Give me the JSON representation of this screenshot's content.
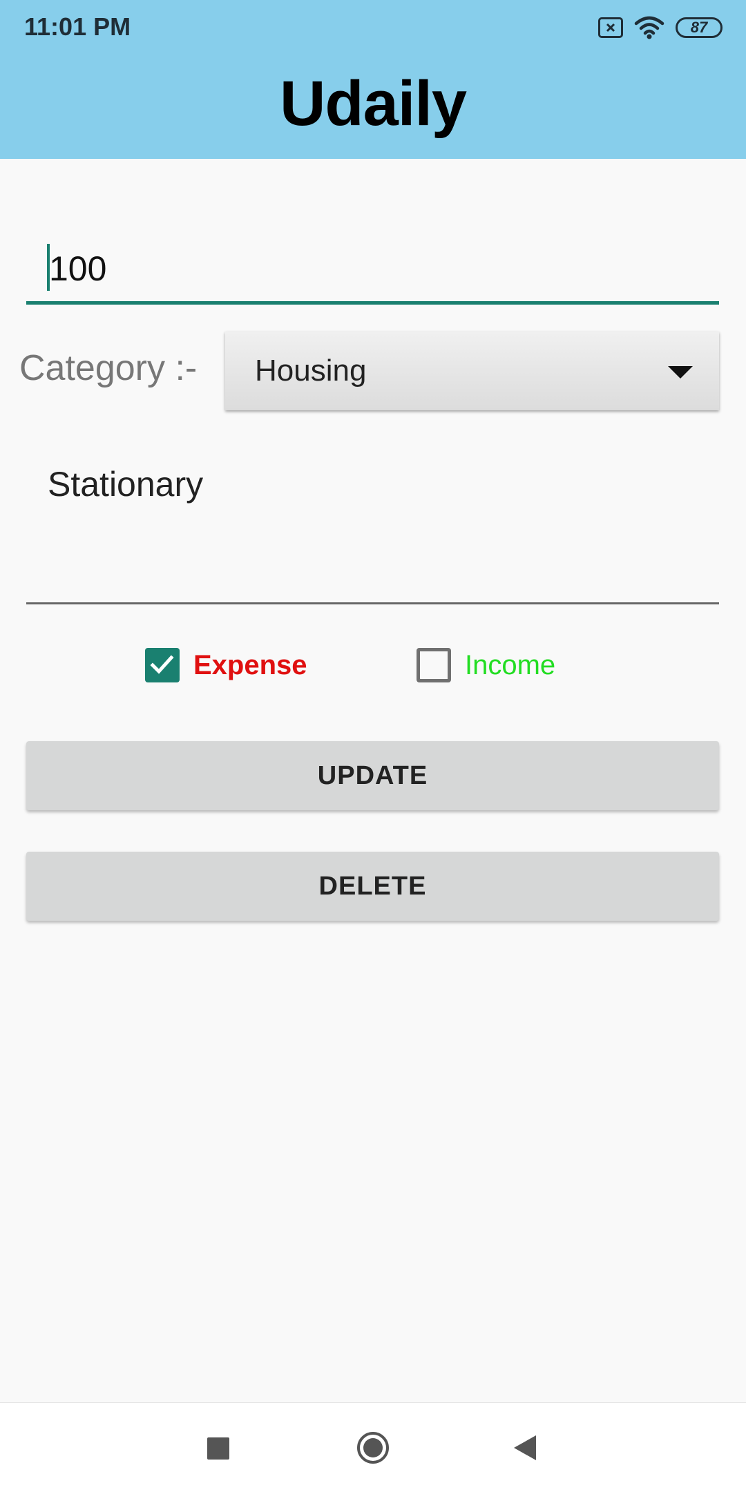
{
  "status_bar": {
    "time": "11:01 PM",
    "battery": "87",
    "icons": [
      "no-sim-icon",
      "wifi-icon",
      "battery-icon"
    ]
  },
  "app": {
    "title": "Udaily"
  },
  "form": {
    "amount_value": "100",
    "category_label": "Category :-",
    "category_selected": "Housing",
    "description_value": "Stationary",
    "expense_label": "Expense",
    "expense_checked": true,
    "income_label": "Income",
    "income_checked": false
  },
  "buttons": {
    "update_label": "UPDATE",
    "delete_label": "DELETE"
  },
  "nav": {
    "icons": [
      "recents-icon",
      "home-icon",
      "back-icon"
    ]
  },
  "colors": {
    "header_bg": "#87ceeb",
    "accent": "#1a8070",
    "expense": "#e01010",
    "income": "#22dd22",
    "button_bg": "#d6d7d7"
  }
}
